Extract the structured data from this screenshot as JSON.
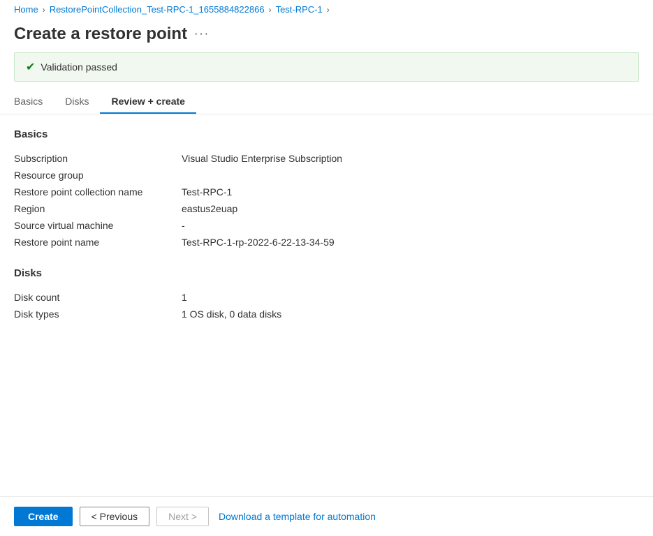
{
  "breadcrumb": {
    "home": "Home",
    "collection": "RestorePointCollection_Test-RPC-1_1655884822866",
    "rpc": "Test-RPC-1"
  },
  "page": {
    "title": "Create a restore point",
    "more_label": "···"
  },
  "validation": {
    "message": "Validation passed"
  },
  "tabs": [
    {
      "id": "basics",
      "label": "Basics",
      "active": false
    },
    {
      "id": "disks",
      "label": "Disks",
      "active": false
    },
    {
      "id": "review",
      "label": "Review + create",
      "active": true
    }
  ],
  "basics_section": {
    "title": "Basics",
    "rows": [
      {
        "label": "Subscription",
        "value": "Visual Studio Enterprise Subscription"
      },
      {
        "label": "Resource group",
        "value": ""
      },
      {
        "label": "Restore point collection name",
        "value": "Test-RPC-1"
      },
      {
        "label": "Region",
        "value": "eastus2euap"
      },
      {
        "label": "Source virtual machine",
        "value": "-"
      },
      {
        "label": "Restore point name",
        "value": "Test-RPC-1-rp-2022-6-22-13-34-59"
      }
    ]
  },
  "disks_section": {
    "title": "Disks",
    "rows": [
      {
        "label": "Disk count",
        "value": "1"
      },
      {
        "label": "Disk types",
        "value": "1 OS disk, 0 data disks"
      }
    ]
  },
  "footer": {
    "create_label": "Create",
    "previous_label": "< Previous",
    "next_label": "Next >",
    "download_label": "Download a template for automation"
  }
}
